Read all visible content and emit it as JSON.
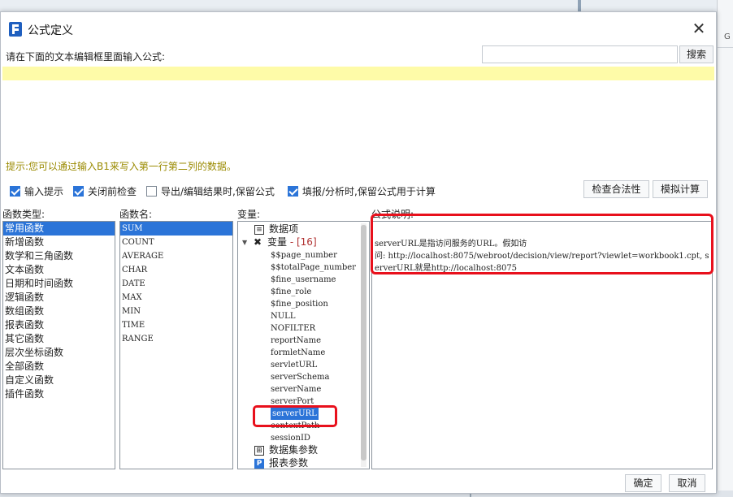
{
  "background": {
    "right_letter": "G"
  },
  "dialog": {
    "title": "公式定义",
    "close_glyph": "✕"
  },
  "editor": {
    "instruction": "请在下面的文本编辑框里面输入公式:",
    "search_placeholder": "",
    "search_label": "搜索",
    "hint": "提示:您可以通过输入B1来写入第一行第二列的数据。"
  },
  "options": {
    "input_hint": "输入提示",
    "check_before_close": "关闭前检查",
    "keep_formula_export": "导出/编辑结果时,保留公式",
    "keep_formula_fill": "填报/分析时,保留公式用于计算",
    "check_validity": "检查合法性",
    "simulate": "模拟计算"
  },
  "function_types": {
    "label": "函数类型:",
    "items": [
      "常用函数",
      "新增函数",
      "数学和三角函数",
      "文本函数",
      "日期和时间函数",
      "逻辑函数",
      "数组函数",
      "报表函数",
      "其它函数",
      "层次坐标函数",
      "全部函数",
      "自定义函数",
      "插件函数"
    ]
  },
  "function_names": {
    "label": "函数名:",
    "items": [
      "SUM",
      "COUNT",
      "AVERAGE",
      "CHAR",
      "DATE",
      "MAX",
      "MIN",
      "TIME",
      "RANGE"
    ]
  },
  "variables": {
    "label": "变量:",
    "dataset_item": "数据项",
    "var_node": "变量",
    "var_count": "- [16]",
    "items": [
      "$$page_number",
      "$$totalPage_number",
      "$fine_username",
      "$fine_role",
      "$fine_position",
      "NULL",
      "NOFILTER",
      "reportName",
      "formletName",
      "servletURL",
      "serverSchema",
      "serverName",
      "serverPort",
      "serverURL",
      "contextPath",
      "sessionID"
    ],
    "dataset_params": "数据集参数",
    "report_params": "报表参数"
  },
  "description": {
    "label": "公式说明:",
    "line1": "serverURL是指访问服务的URL。假如访",
    "line2": "问: http://localhost:8075/webroot/decision/view/report?viewlet=workbook1.cpt, serverURL就是http://localhost:8075"
  },
  "footer": {
    "ok": "确定",
    "cancel": "取消"
  }
}
